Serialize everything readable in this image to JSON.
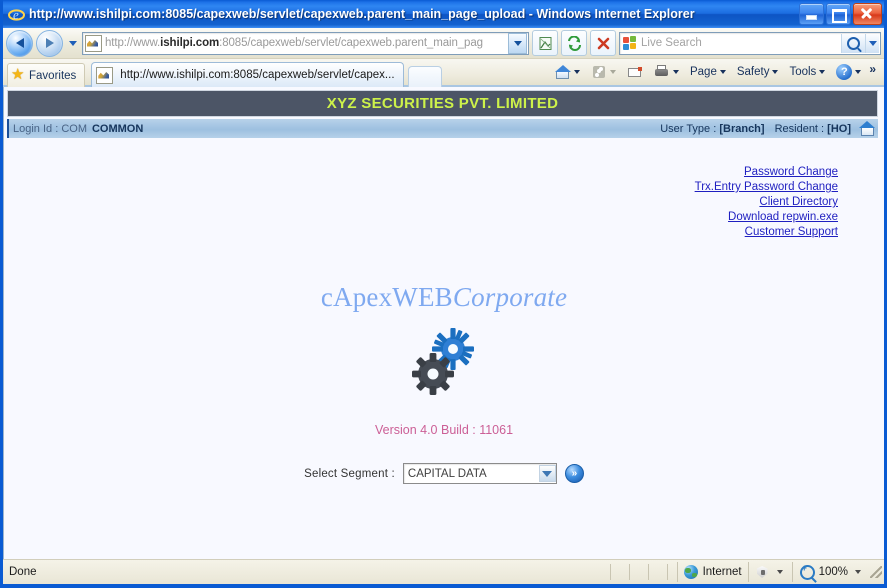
{
  "window": {
    "title": "http://www.ishilpi.com:8085/capexweb/servlet/capexweb.parent_main_page_upload - Windows Internet Explorer",
    "minimize_label": "Minimize",
    "maximize_label": "Maximize",
    "close_label": "Close"
  },
  "navbar": {
    "back_label": "Back",
    "forward_label": "Forward",
    "recent_pages_label": "Recent Pages",
    "address_prefix": "http://www.",
    "address_domain": "ishilpi.com",
    "address_suffix": ":8085/capexweb/servlet/capexweb.parent_main_pag",
    "address_full": "http://www.ishilpi.com:8085/capexweb/servlet/capexweb.parent_main_page_upload",
    "compat_label": "Compatibility View",
    "refresh_label": "Refresh",
    "stop_label": "Stop",
    "search_placeholder": "Live Search",
    "search_value": "",
    "search_go_label": "Search",
    "search_provider_label": "Change Search Provider"
  },
  "tabbar": {
    "favorites_label": "Favorites",
    "tab_title": "http://www.ishilpi.com:8085/capexweb/servlet/capex...",
    "new_tab_label": "New Tab",
    "commands": [
      {
        "label": "Home",
        "icon": "home-icon",
        "caret": true
      },
      {
        "label": "Feeds",
        "icon": "feed-icon",
        "caret": true,
        "dim": true
      },
      {
        "label": "Read Mail",
        "icon": "mail-icon",
        "caret": false
      },
      {
        "label": "Print",
        "icon": "print-icon",
        "caret": true
      },
      {
        "label": "Page",
        "icon": "",
        "caret": true
      },
      {
        "label": "Safety",
        "icon": "",
        "caret": true
      },
      {
        "label": "Tools",
        "icon": "",
        "caret": true
      },
      {
        "label": "Help",
        "icon": "help-icon",
        "caret": true
      }
    ],
    "overflow_label": "»"
  },
  "page": {
    "banner_title": "XYZ SECURITIES PVT. LIMITED",
    "banner_bg": "#4c5566",
    "banner_color": "#cdf24a",
    "infobar": {
      "login_label": "Login Id : COM",
      "login_value": "COMMON",
      "user_type_label": "User Type :",
      "user_type_value": "[Branch]",
      "resident_label": "Resident :",
      "resident_value": "[HO]",
      "home_icon": "home-icon"
    },
    "links": [
      {
        "label": "Password Change"
      },
      {
        "label": "Trx.Entry Password Change"
      },
      {
        "label": "Client Directory"
      },
      {
        "label": "Download repwin.exe"
      },
      {
        "label": "Customer Support"
      }
    ],
    "brand_part1": "cApexWEB",
    "brand_part2": "Corporate",
    "brand_color": "#7fa9f0",
    "logo_icon": "gears-icon",
    "version": "Version 4.0 Build : 11061",
    "version_color": "#cc5f96",
    "segment_label": "Select Segment :",
    "segment_value": "CAPITAL DATA",
    "segment_options": [
      "CAPITAL DATA"
    ],
    "segment_go_label": "»"
  },
  "statusbar": {
    "status_text": "Done",
    "zone_label": "Internet",
    "zone_icon": "globe-icon",
    "protected_mode_icon": "shield-icon",
    "zoom_level": "100%",
    "zoom_icon": "zoom-icon"
  }
}
